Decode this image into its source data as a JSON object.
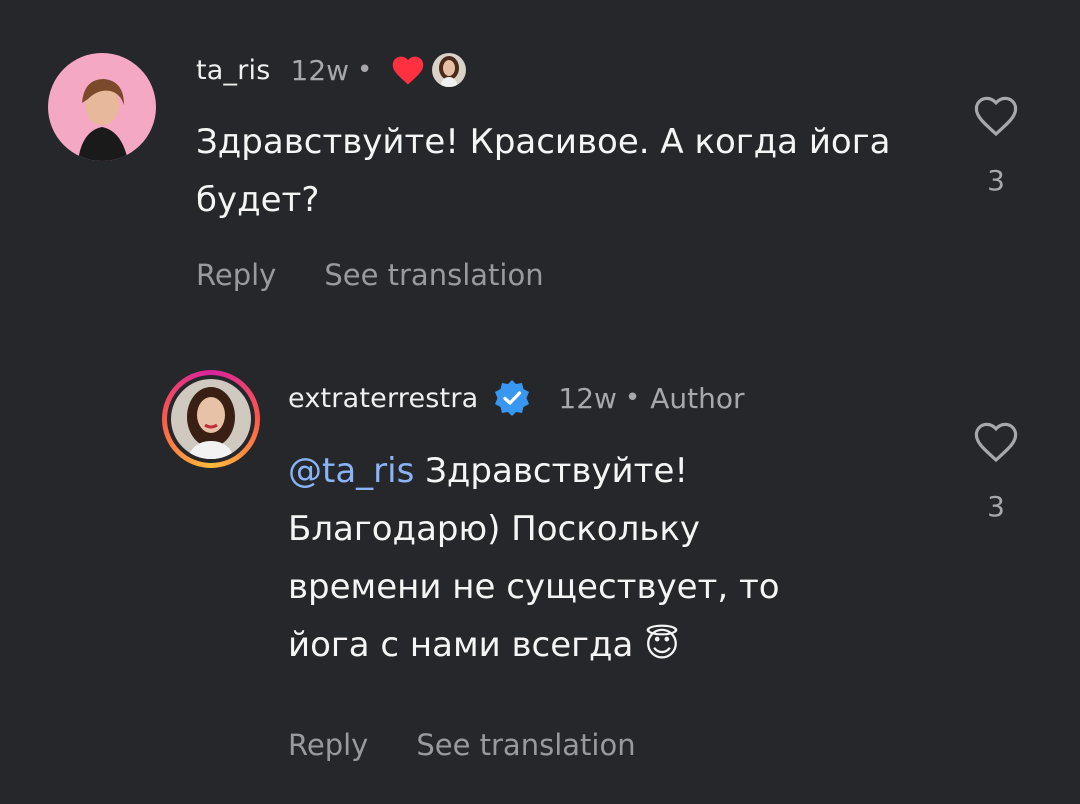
{
  "comments": [
    {
      "username": "ta_ris",
      "time": "12w",
      "dot": "•",
      "body": "Здравствуйте! Красивое. А когда йога будет?",
      "reply_label": "Reply",
      "translate_label": "See translation",
      "like_count": "3",
      "liked_by_author_icon": "heart-icon"
    },
    {
      "username": "extraterrestra",
      "verified_icon": "verified-badge-icon",
      "time": "12w",
      "dot": "•",
      "author_label": "Author",
      "mention": "@ta_ris",
      "body": "Здравствуйте! Благодарю) Поскольку времени не существует, то йога с нами всегда",
      "emoji": "😇",
      "reply_label": "Reply",
      "translate_label": "See translation",
      "like_count": "3"
    }
  ],
  "colors": {
    "background": "#26272b",
    "mention": "#8ab4f8",
    "heart": "#ff3040",
    "verified": "#3897f0"
  }
}
